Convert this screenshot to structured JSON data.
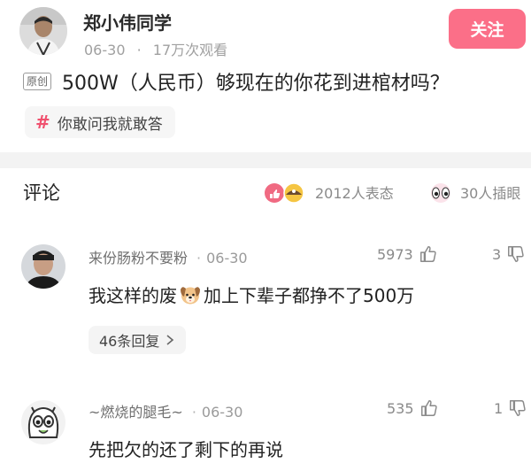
{
  "post": {
    "author": "郑小伟同学",
    "date": "06-30",
    "views": "17万次观看",
    "follow_label": "关注",
    "original_tag": "原创",
    "title": "500W（人民币）够现在的你花到进棺材吗？",
    "topic": "你敢问我就敢答"
  },
  "comments_header": {
    "title": "评论",
    "reactions": "2012人表态",
    "peeks": "30人插眼"
  },
  "comments": [
    {
      "user": "来份肠粉不要粉",
      "date": "06-30",
      "likes": "5973",
      "dislikes": "3",
      "text_before": "我这样的废",
      "text_after": "加上下辈子都挣不了500万",
      "replies": "46条回复"
    },
    {
      "user": "~燃烧的腿毛~",
      "date": "06-30",
      "likes": "535",
      "dislikes": "1",
      "text": "先把欠的还了剩下的再说"
    }
  ],
  "colors": {
    "follow_bg": "#fb6f88",
    "topic_hash": "#f0506e"
  },
  "icons": [
    "thumbs-up-icon",
    "thumbs-down-icon",
    "chevron-right-icon",
    "dog-emoji-icon",
    "hash-icon"
  ]
}
